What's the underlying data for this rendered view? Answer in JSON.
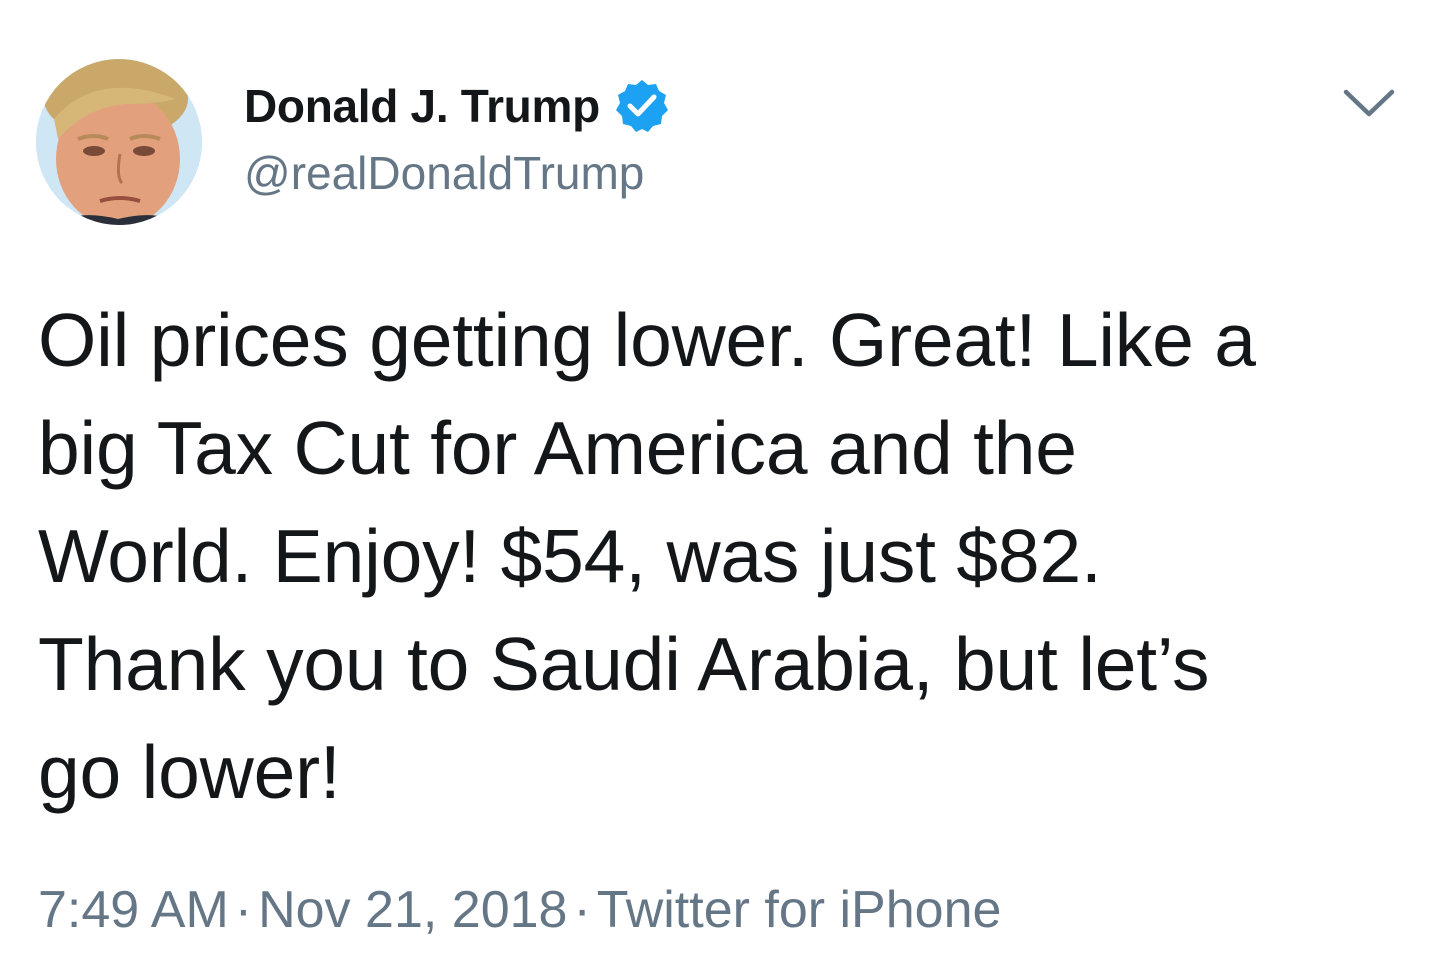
{
  "author": {
    "display_name": "Donald J. Trump",
    "handle": "@realDonaldTrump",
    "verified": true,
    "avatar_icon": "avatar-photo"
  },
  "tweet": {
    "text": "Oil prices getting lower. Great! Like a\nbig Tax Cut for America and the\nWorld. Enjoy! $54, was just $82.\nThank you to Saudi Arabia, but let’s\ngo lower!"
  },
  "meta": {
    "time": "7:49 AM",
    "date": "Nov 21, 2018",
    "source": "Twitter for iPhone",
    "separator": "·"
  },
  "icons": {
    "verified": "verified-badge-icon",
    "menu": "chevron-down-icon"
  },
  "colors": {
    "text_primary": "#14171a",
    "text_secondary": "#657786",
    "verified_blue": "#1da1f2",
    "background": "#ffffff"
  }
}
